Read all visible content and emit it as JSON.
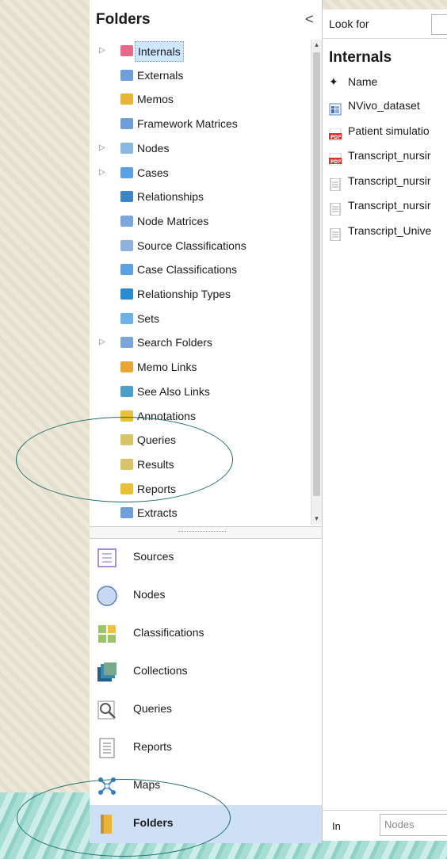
{
  "nav": {
    "title": "Folders",
    "collapse_glyph": "<",
    "tree": [
      {
        "label": "Internals",
        "expandable": true,
        "selected": true,
        "icon": "internals-icon",
        "color": "#e86a8a"
      },
      {
        "label": "Externals",
        "expandable": false,
        "icon": "externals-icon",
        "color": "#6f9fd8"
      },
      {
        "label": "Memos",
        "expandable": false,
        "icon": "memos-icon",
        "color": "#e8b43a"
      },
      {
        "label": "Framework Matrices",
        "expandable": false,
        "icon": "framework-matrices-icon",
        "color": "#6f9fd8"
      },
      {
        "label": "Nodes",
        "expandable": true,
        "icon": "nodes-icon",
        "color": "#8bb8e0"
      },
      {
        "label": "Cases",
        "expandable": true,
        "icon": "cases-icon",
        "color": "#5ba0e0"
      },
      {
        "label": "Relationships",
        "expandable": false,
        "icon": "relationships-icon",
        "color": "#3e86c8"
      },
      {
        "label": "Node Matrices",
        "expandable": false,
        "icon": "node-matrices-icon",
        "color": "#7aa6dc"
      },
      {
        "label": "Source Classifications",
        "expandable": false,
        "icon": "source-classifications-icon",
        "color": "#8fb2dc"
      },
      {
        "label": "Case Classifications",
        "expandable": false,
        "icon": "case-classifications-icon",
        "color": "#5ba0e0"
      },
      {
        "label": "Relationship Types",
        "expandable": false,
        "icon": "relationship-types-icon",
        "color": "#2e8ad0"
      },
      {
        "label": "Sets",
        "expandable": false,
        "icon": "sets-icon",
        "color": "#6fb0e8"
      },
      {
        "label": "Search Folders",
        "expandable": true,
        "icon": "search-folders-icon",
        "color": "#7aa6dc"
      },
      {
        "label": "Memo Links",
        "expandable": false,
        "icon": "memo-links-icon",
        "color": "#e8a63a"
      },
      {
        "label": "See Also Links",
        "expandable": false,
        "icon": "see-also-links-icon",
        "color": "#4aa0c8"
      },
      {
        "label": "Annotations",
        "expandable": false,
        "icon": "annotations-icon",
        "color": "#e8c03a"
      },
      {
        "label": "Queries",
        "expandable": false,
        "icon": "queries-icon",
        "color": "#d8c46a"
      },
      {
        "label": "Results",
        "expandable": false,
        "icon": "results-icon",
        "color": "#d8c46a"
      },
      {
        "label": "Reports",
        "expandable": false,
        "icon": "reports-icon",
        "color": "#e8c03a"
      },
      {
        "label": "Extracts",
        "expandable": false,
        "icon": "extracts-icon",
        "color": "#6f9fd8"
      }
    ],
    "buttons": [
      {
        "label": "Sources",
        "icon": "sources-icon",
        "active": false
      },
      {
        "label": "Nodes",
        "icon": "nodes-circle-icon",
        "active": false
      },
      {
        "label": "Classifications",
        "icon": "classifications-icon",
        "active": false
      },
      {
        "label": "Collections",
        "icon": "collections-icon",
        "active": false
      },
      {
        "label": "Queries",
        "icon": "queries-magnifier-icon",
        "active": false
      },
      {
        "label": "Reports",
        "icon": "reports-doc-icon",
        "active": false
      },
      {
        "label": "Maps",
        "icon": "maps-icon",
        "active": false
      },
      {
        "label": "Folders",
        "icon": "folders-icon",
        "active": true
      }
    ]
  },
  "panel": {
    "look_for_label": "Look for",
    "title": "Internals",
    "column_name": "Name",
    "items": [
      {
        "name": "NVivo_dataset",
        "type": "dataset"
      },
      {
        "name": "Patient simulatio",
        "type": "pdf"
      },
      {
        "name": "Transcript_nursir",
        "type": "pdf"
      },
      {
        "name": "Transcript_nursir",
        "type": "doc"
      },
      {
        "name": "Transcript_nursir",
        "type": "doc"
      },
      {
        "name": "Transcript_Unive",
        "type": "doc"
      }
    ],
    "in_label": "In",
    "in_value": "Nodes"
  },
  "colors": {
    "highlight_circle": "#1c6b66",
    "active_nav": "#cde0f5",
    "selection": "#cfe6ff"
  }
}
